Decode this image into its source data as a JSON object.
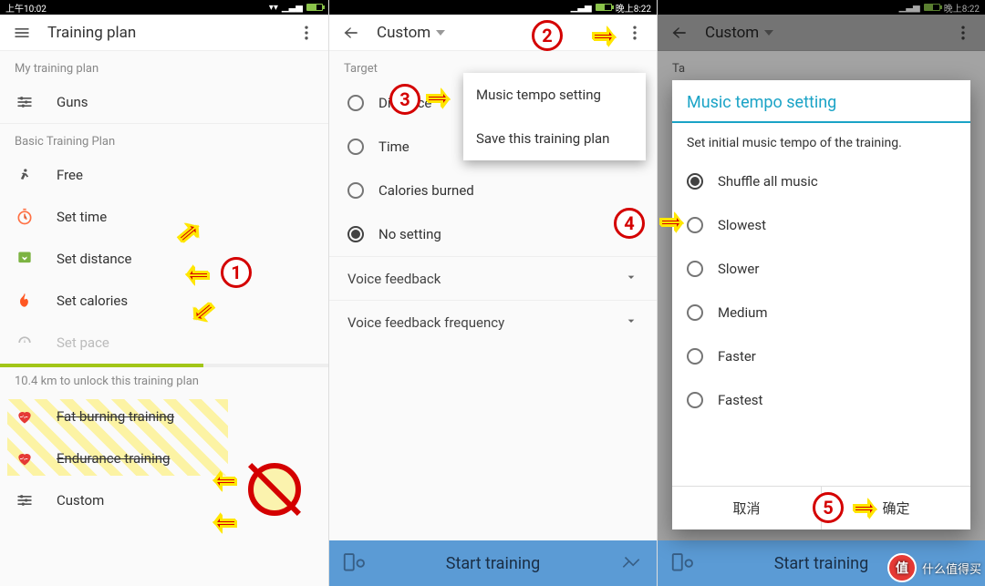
{
  "statusbar": {
    "pane1_time": "上午10:02",
    "pane2_time": "晚上8:22",
    "pane3_time": "晚上8:22"
  },
  "pane1": {
    "title": "Training plan",
    "section_my": "My training plan",
    "item_guns": "Guns",
    "section_basic": "Basic Training Plan",
    "item_free": "Free",
    "item_set_time": "Set time",
    "item_set_distance": "Set distance",
    "item_set_calories": "Set calories",
    "item_set_pace": "Set pace",
    "unlock_text": "10.4 km to unlock this training plan",
    "item_fat_burning": "Fat burning training",
    "item_endurance": "Endurance training",
    "item_custom": "Custom"
  },
  "pane2": {
    "title": "Custom",
    "section_target": "Target",
    "opt_distance": "Distance",
    "opt_time": "Time",
    "opt_calories": "Calories burned",
    "opt_nosetting": "No setting",
    "row_voice_feedback": "Voice feedback",
    "row_voice_freq": "Voice feedback frequency",
    "menu_music_tempo": "Music tempo setting",
    "menu_save_plan": "Save this training plan",
    "start_btn": "Start training"
  },
  "pane3": {
    "title": "Custom",
    "section_target": "Ta",
    "dialog_title": "Music tempo setting",
    "dialog_sub": "Set initial music tempo of the training.",
    "opt_shuffle": "Shuffle all music",
    "opt_slowest": "Slowest",
    "opt_slower": "Slower",
    "opt_medium": "Medium",
    "opt_faster": "Faster",
    "opt_fastest": "Fastest",
    "btn_cancel": "取消",
    "btn_ok": "确定",
    "start_btn": "Start training"
  },
  "annotations": {
    "m1": "1",
    "m2": "2",
    "m3": "3",
    "m4": "4",
    "m5": "5"
  },
  "watermark": {
    "badge": "值",
    "text": "什么值得买"
  }
}
